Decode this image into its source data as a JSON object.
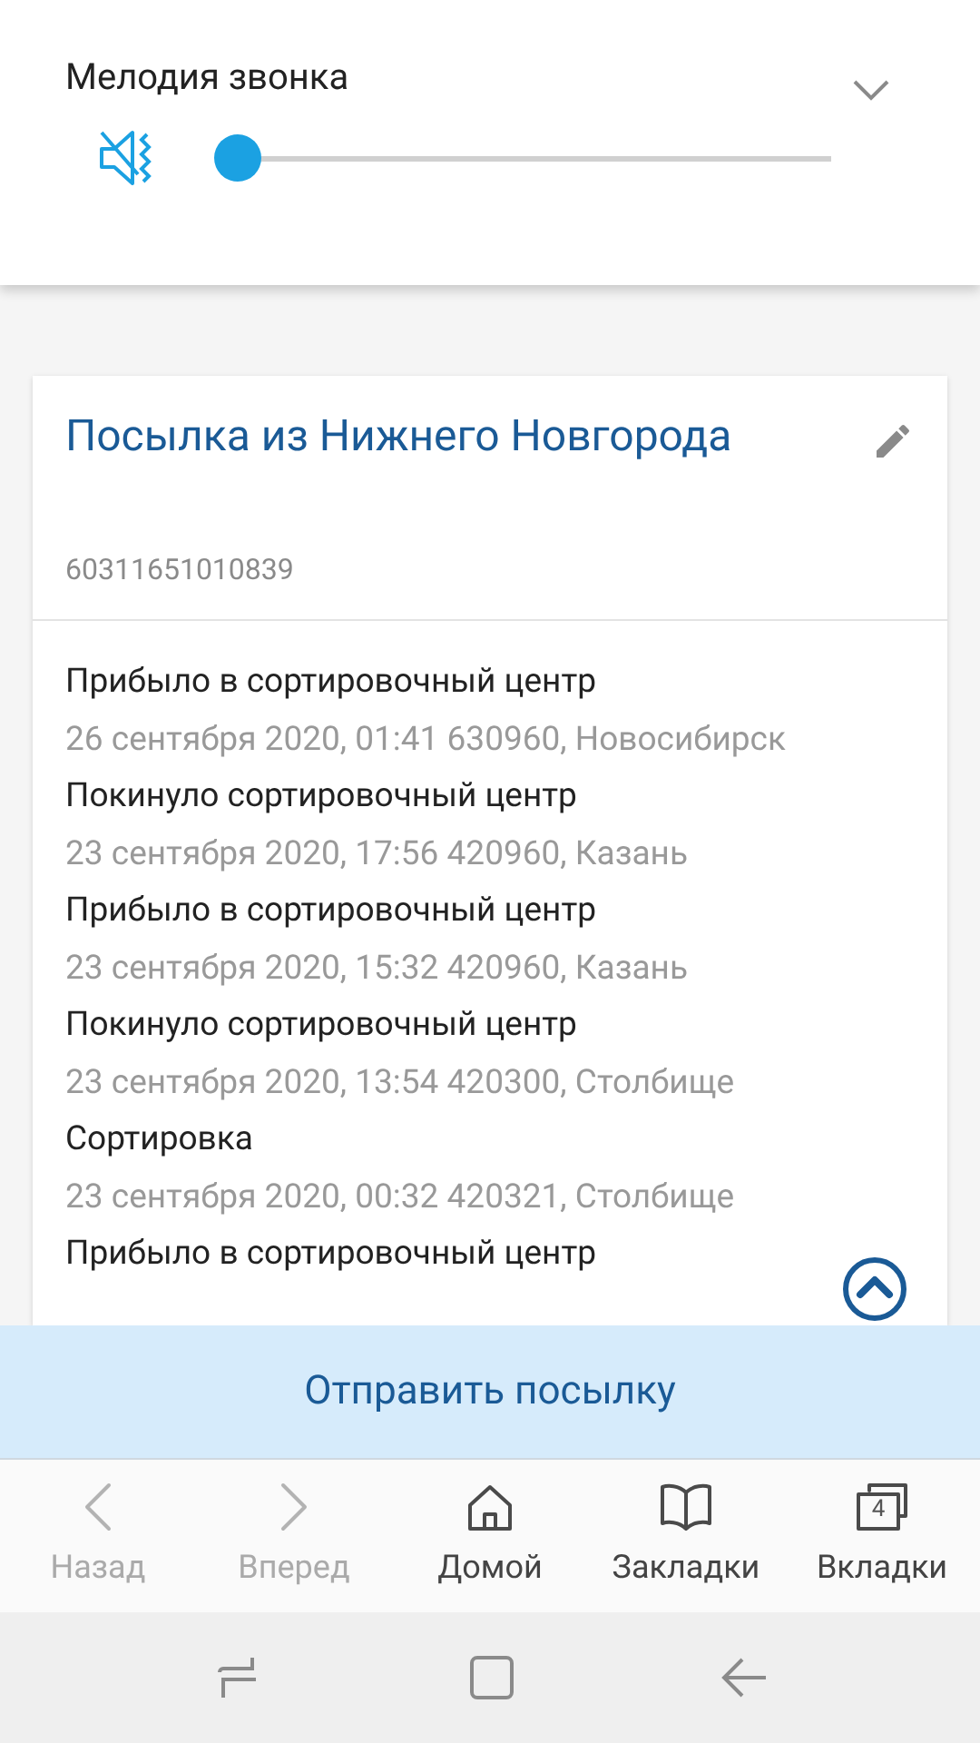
{
  "volume_panel": {
    "title": "Мелодия звонка",
    "muted": true,
    "level": 0
  },
  "parcel": {
    "title": "Посылка из Нижнего Новгорода",
    "tracking_number": "60311651010839",
    "events": [
      {
        "status": "Прибыло в сортировочный центр",
        "details": "26 сентября 2020, 01:41 630960, Новосибирск"
      },
      {
        "status": "Покинуло сортировочный центр",
        "details": "23 сентября 2020, 17:56 420960, Казань"
      },
      {
        "status": "Прибыло в сортировочный центр",
        "details": "23 сентября 2020, 15:32 420960, Казань"
      },
      {
        "status": "Покинуло сортировочный центр",
        "details": "23 сентября 2020, 13:54 420300, Столбище"
      },
      {
        "status": "Сортировка",
        "details": "23 сентября 2020, 00:32 420321, Столбище"
      },
      {
        "status": "Прибыло в сортировочный центр"
      }
    ]
  },
  "send_button": "Отправить посылку",
  "browser_nav": [
    {
      "label": "Назад",
      "kind": "back",
      "disabled": true
    },
    {
      "label": "Вперед",
      "kind": "forward",
      "disabled": true
    },
    {
      "label": "Домой",
      "kind": "home",
      "disabled": false
    },
    {
      "label": "Закладки",
      "kind": "bookmarks",
      "disabled": false
    },
    {
      "label": "Вкладки",
      "kind": "tabs",
      "disabled": false,
      "badge": "4"
    }
  ]
}
